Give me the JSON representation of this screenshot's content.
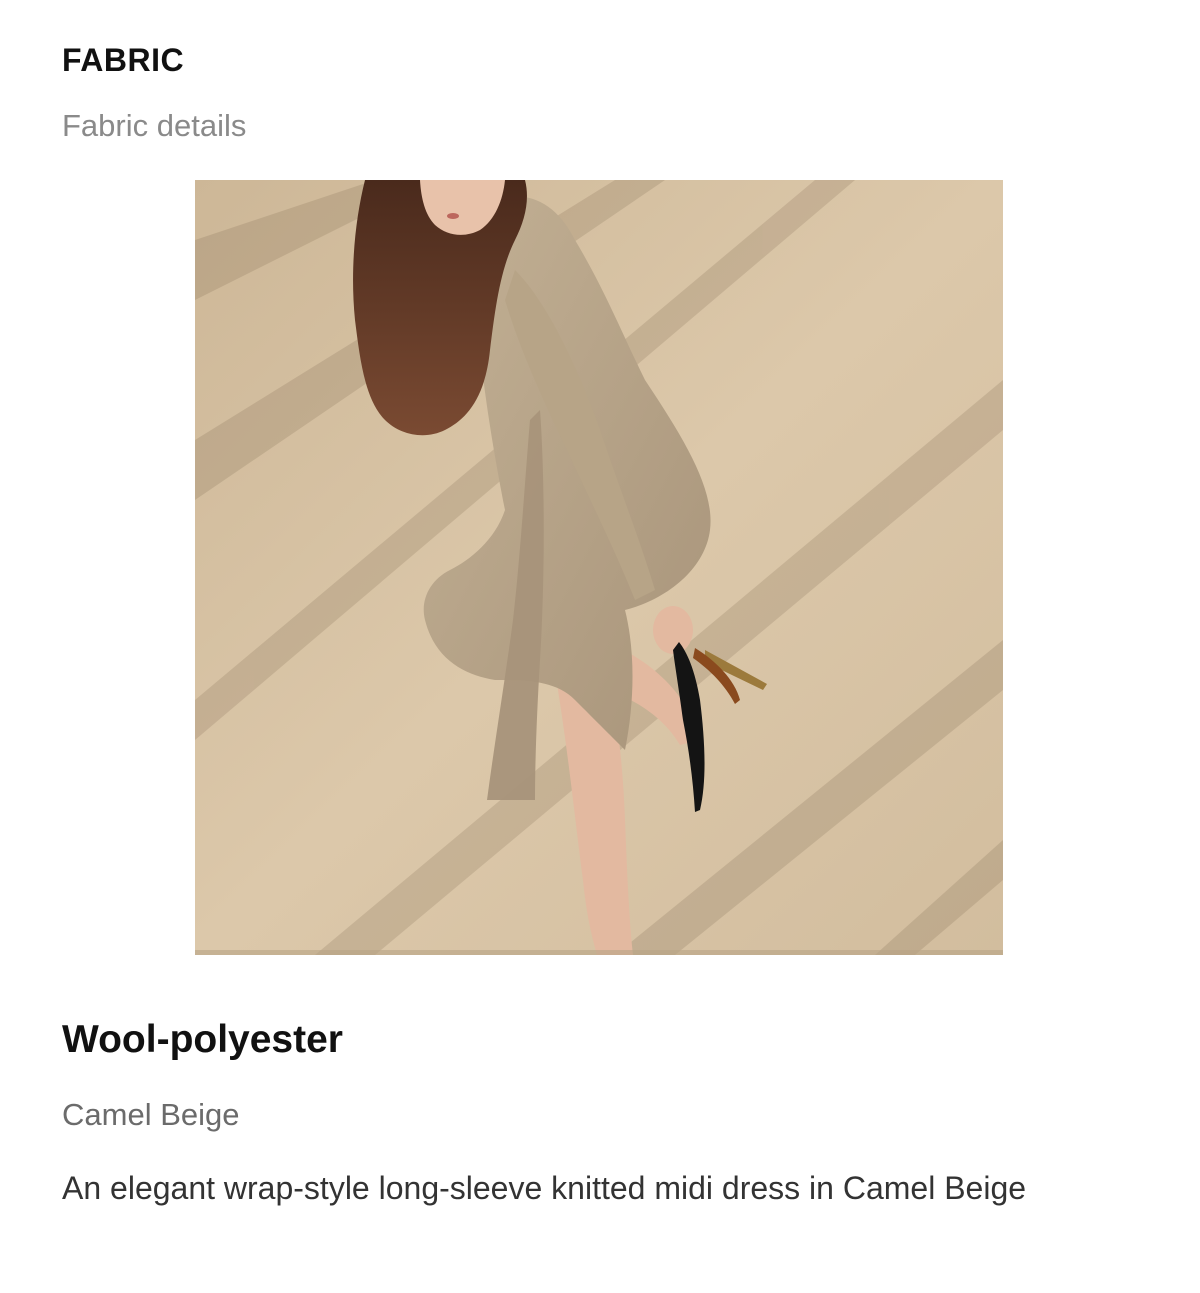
{
  "section": {
    "title": "FABRIC",
    "subtitle": "Fabric details"
  },
  "photo": {
    "icon": "product-photo"
  },
  "fabric": {
    "name": "Wool-polyester",
    "color": "Camel Beige",
    "description": "An elegant wrap-style long-sleeve knitted midi dress in Camel Beige"
  },
  "colors": {
    "backdrop": "#d8c3a5",
    "dress": "#b9a68a",
    "hair": "#5a3424",
    "skin": "#e3b9a0",
    "shoe": "#141414"
  }
}
